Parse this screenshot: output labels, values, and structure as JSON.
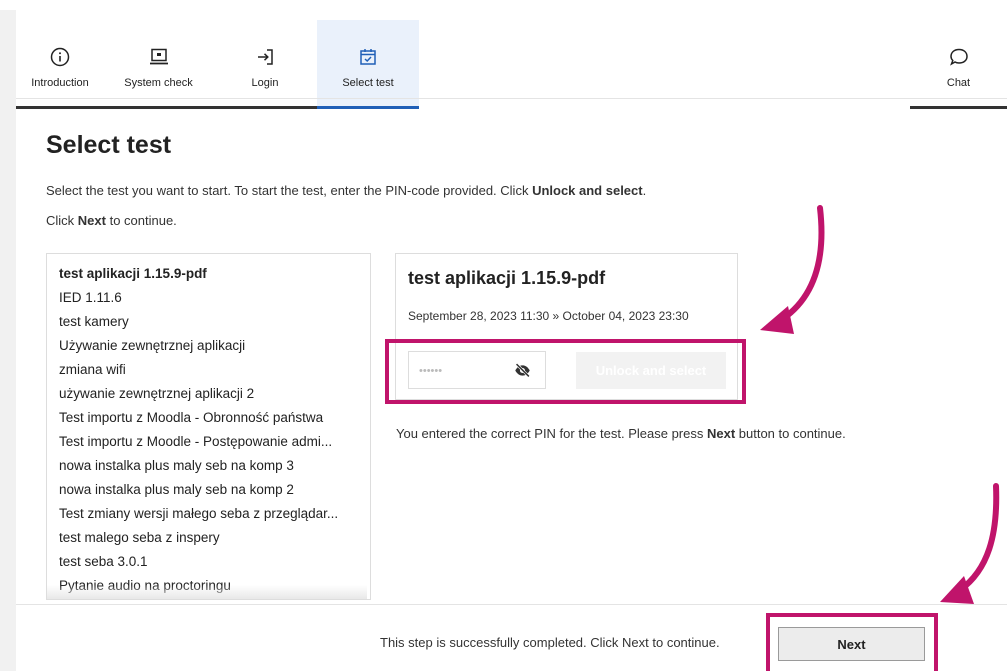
{
  "nav": {
    "items": [
      {
        "label": "Introduction",
        "icon": "info-icon",
        "state": "done"
      },
      {
        "label": "System check",
        "icon": "laptop-icon",
        "state": "done"
      },
      {
        "label": "Login",
        "icon": "login-icon",
        "state": "done"
      },
      {
        "label": "Select test",
        "icon": "calendar-check-icon",
        "state": "active"
      }
    ],
    "chat": {
      "label": "Chat",
      "icon": "chat-bubble-icon"
    }
  },
  "page": {
    "title": "Select test",
    "instruction_pre": "Select the test you want to start. To start the test, enter the PIN-code provided. Click ",
    "instruction_bold": "Unlock and select",
    "instruction_post": ".",
    "next_pre": "Click ",
    "next_bold": "Next",
    "next_post": " to continue."
  },
  "tests": [
    "test aplikacji 1.15.9-pdf",
    "IED 1.11.6",
    "test kamery",
    "Używanie zewnętrznej aplikacji",
    "zmiana wifi",
    "używanie zewnętrznej aplikacji 2",
    "Test importu z Moodla - Obronność państwa",
    "Test importu z Moodle - Postępowanie admi...",
    "nowa instalka plus maly seb na komp 3",
    "nowa instalka plus maly seb na komp 2",
    "Test zmiany wersji małego seba z przeglądar...",
    "test malego seba z inspery",
    "test seba 3.0.1",
    "Pytanie audio na proctoringu"
  ],
  "detail": {
    "title": "test aplikacji 1.15.9-pdf",
    "dates": "September 28, 2023 11:30 » October 04, 2023 23:30",
    "pin_value": "••••••",
    "unlock_label": "Unlock and select"
  },
  "message": {
    "pre": "You entered the correct PIN for the test. Please press ",
    "bold": "Next",
    "post": " button to continue."
  },
  "footer": {
    "text": "This step is successfully completed. Click Next to continue.",
    "next_label": "Next"
  },
  "colors": {
    "accent": "#1f5fb7",
    "highlight": "#c0146b"
  }
}
